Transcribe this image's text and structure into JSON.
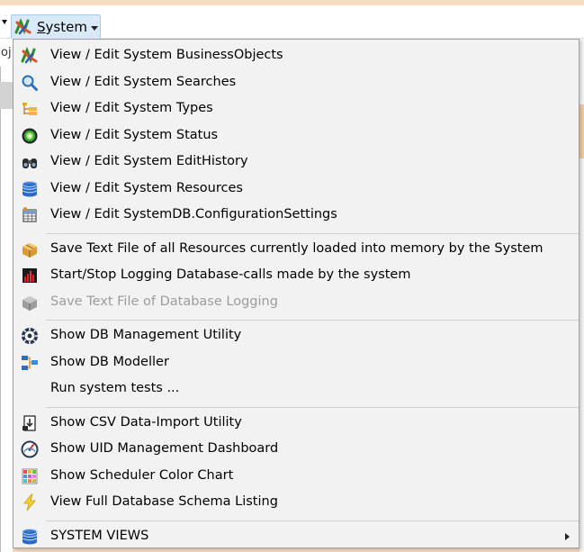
{
  "menubar": {
    "label": "System"
  },
  "background": {
    "fragment": "oj"
  },
  "menu": {
    "groups": [
      [
        {
          "label": "View / Edit System BusinessObjects",
          "icon": "business-objects-icon"
        },
        {
          "label": "View / Edit System Searches",
          "icon": "magnifier-icon"
        },
        {
          "label": "View / Edit System Types",
          "icon": "type-tree-icon"
        },
        {
          "label": "View / Edit System Status",
          "icon": "status-target-icon"
        },
        {
          "label": "View / Edit System EditHistory",
          "icon": "binoculars-icon"
        },
        {
          "label": "View / Edit System Resources",
          "icon": "database-icon"
        },
        {
          "label": "View / Edit SystemDB.ConfigurationSettings",
          "icon": "settings-table-icon"
        }
      ],
      [
        {
          "label": "Save Text File of all Resources currently loaded into memory by the System",
          "icon": "box-icon"
        },
        {
          "label": "Start/Stop Logging Database-calls made by the system",
          "icon": "bar-chart-icon"
        },
        {
          "label": "Save Text File of Database Logging",
          "icon": "grey-box-icon",
          "disabled": true
        }
      ],
      [
        {
          "label": "Show DB Management Utility",
          "icon": "gear-icon"
        },
        {
          "label": "Show DB Modeller",
          "icon": "modeller-icon"
        },
        {
          "label": "Run system tests ...",
          "icon": ""
        }
      ],
      [
        {
          "label": "Show CSV Data-Import Utility",
          "icon": "import-icon"
        },
        {
          "label": "Show UID Management Dashboard",
          "icon": "dashboard-gauge-icon"
        },
        {
          "label": "Show Scheduler Color Chart",
          "icon": "color-grid-icon"
        },
        {
          "label": "View Full Database Schema Listing",
          "icon": "lightning-icon"
        }
      ],
      [
        {
          "label": "SYSTEM VIEWS",
          "icon": "database-icon",
          "submenu": true
        }
      ]
    ]
  }
}
